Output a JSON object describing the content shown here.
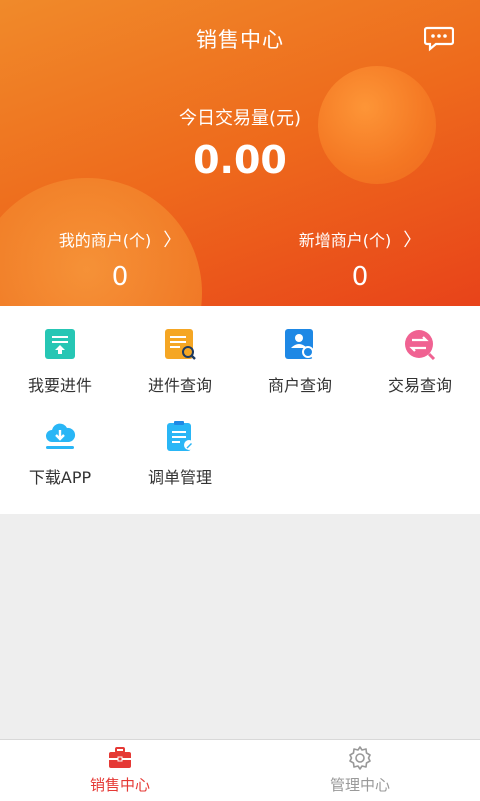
{
  "header": {
    "title": "销售中心",
    "today_label": "今日交易量(元)",
    "today_value": "0.00",
    "my_merchants_label": "我的商户(个)",
    "my_merchants_value": "0",
    "new_merchants_label": "新增商户(个)",
    "new_merchants_value": "0",
    "chevron": "〉"
  },
  "menu": [
    {
      "label": "我要进件",
      "icon": "upload-doc-icon",
      "color": "#26c6b4"
    },
    {
      "label": "进件查询",
      "icon": "doc-search-icon",
      "color": "#f5a623"
    },
    {
      "label": "商户查询",
      "icon": "merchant-search-icon",
      "color": "#1e88e5"
    },
    {
      "label": "交易查询",
      "icon": "exchange-icon",
      "color": "#f06292"
    },
    {
      "label": "下载APP",
      "icon": "cloud-download-icon",
      "color": "#29b6f6"
    },
    {
      "label": "调单管理",
      "icon": "clipboard-edit-icon",
      "color": "#29b6f6"
    }
  ],
  "tabs": [
    {
      "label": "销售中心",
      "icon": "briefcase-icon",
      "color": "#e53935",
      "active": true
    },
    {
      "label": "管理中心",
      "icon": "gear-icon",
      "color": "#999999",
      "active": false
    }
  ]
}
